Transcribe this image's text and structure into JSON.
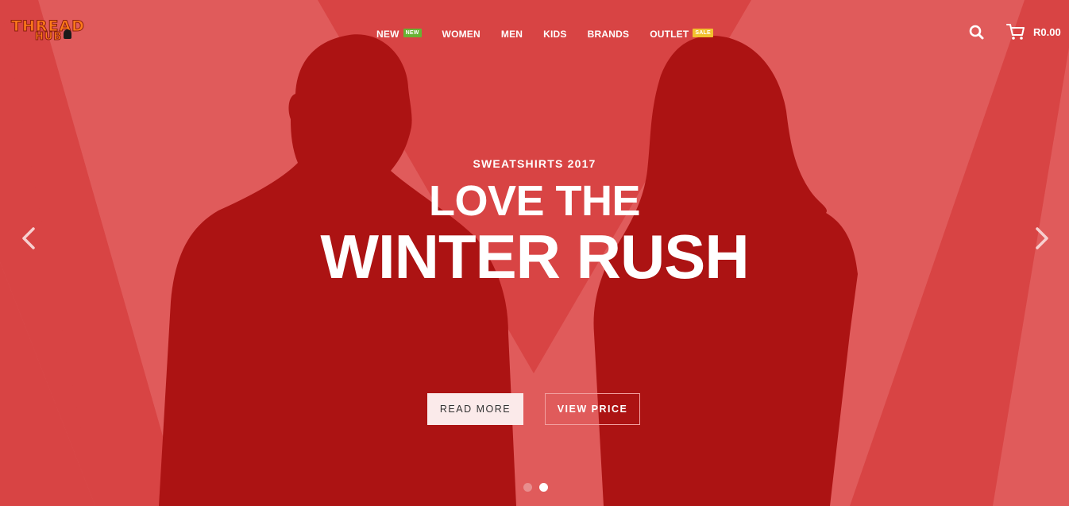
{
  "brand": {
    "logo_top": "THREAD",
    "logo_bottom": "HUB"
  },
  "nav": {
    "items": [
      {
        "label": "NEW",
        "badge": "NEW"
      },
      {
        "label": "WOMEN"
      },
      {
        "label": "MEN"
      },
      {
        "label": "KIDS"
      },
      {
        "label": "BRANDS"
      },
      {
        "label": "OUTLET",
        "badge": "SALE"
      }
    ]
  },
  "cart": {
    "total": "R0.00",
    "icon": "cart-icon"
  },
  "search": {
    "icon": "search-icon"
  },
  "slide": {
    "subtitle": "SWEATSHIRTS 2017",
    "headline_line1": "LOVE THE",
    "headline_line2": "WINTER RUSH",
    "read_more_label": "READ MORE",
    "view_price_label": "VIEW PRICE"
  },
  "slider": {
    "prev_icon": "chevron-left-icon",
    "next_icon": "chevron-right-icon",
    "slide_count": 2,
    "active_slide": 2
  },
  "colors": {
    "background": "#d84444",
    "stripe": "#e05b5b",
    "silhouette": "#ac1313",
    "badge_new": "#68b234",
    "badge_sale": "#f2c12e",
    "logo_orange": "#ff7a1a"
  }
}
